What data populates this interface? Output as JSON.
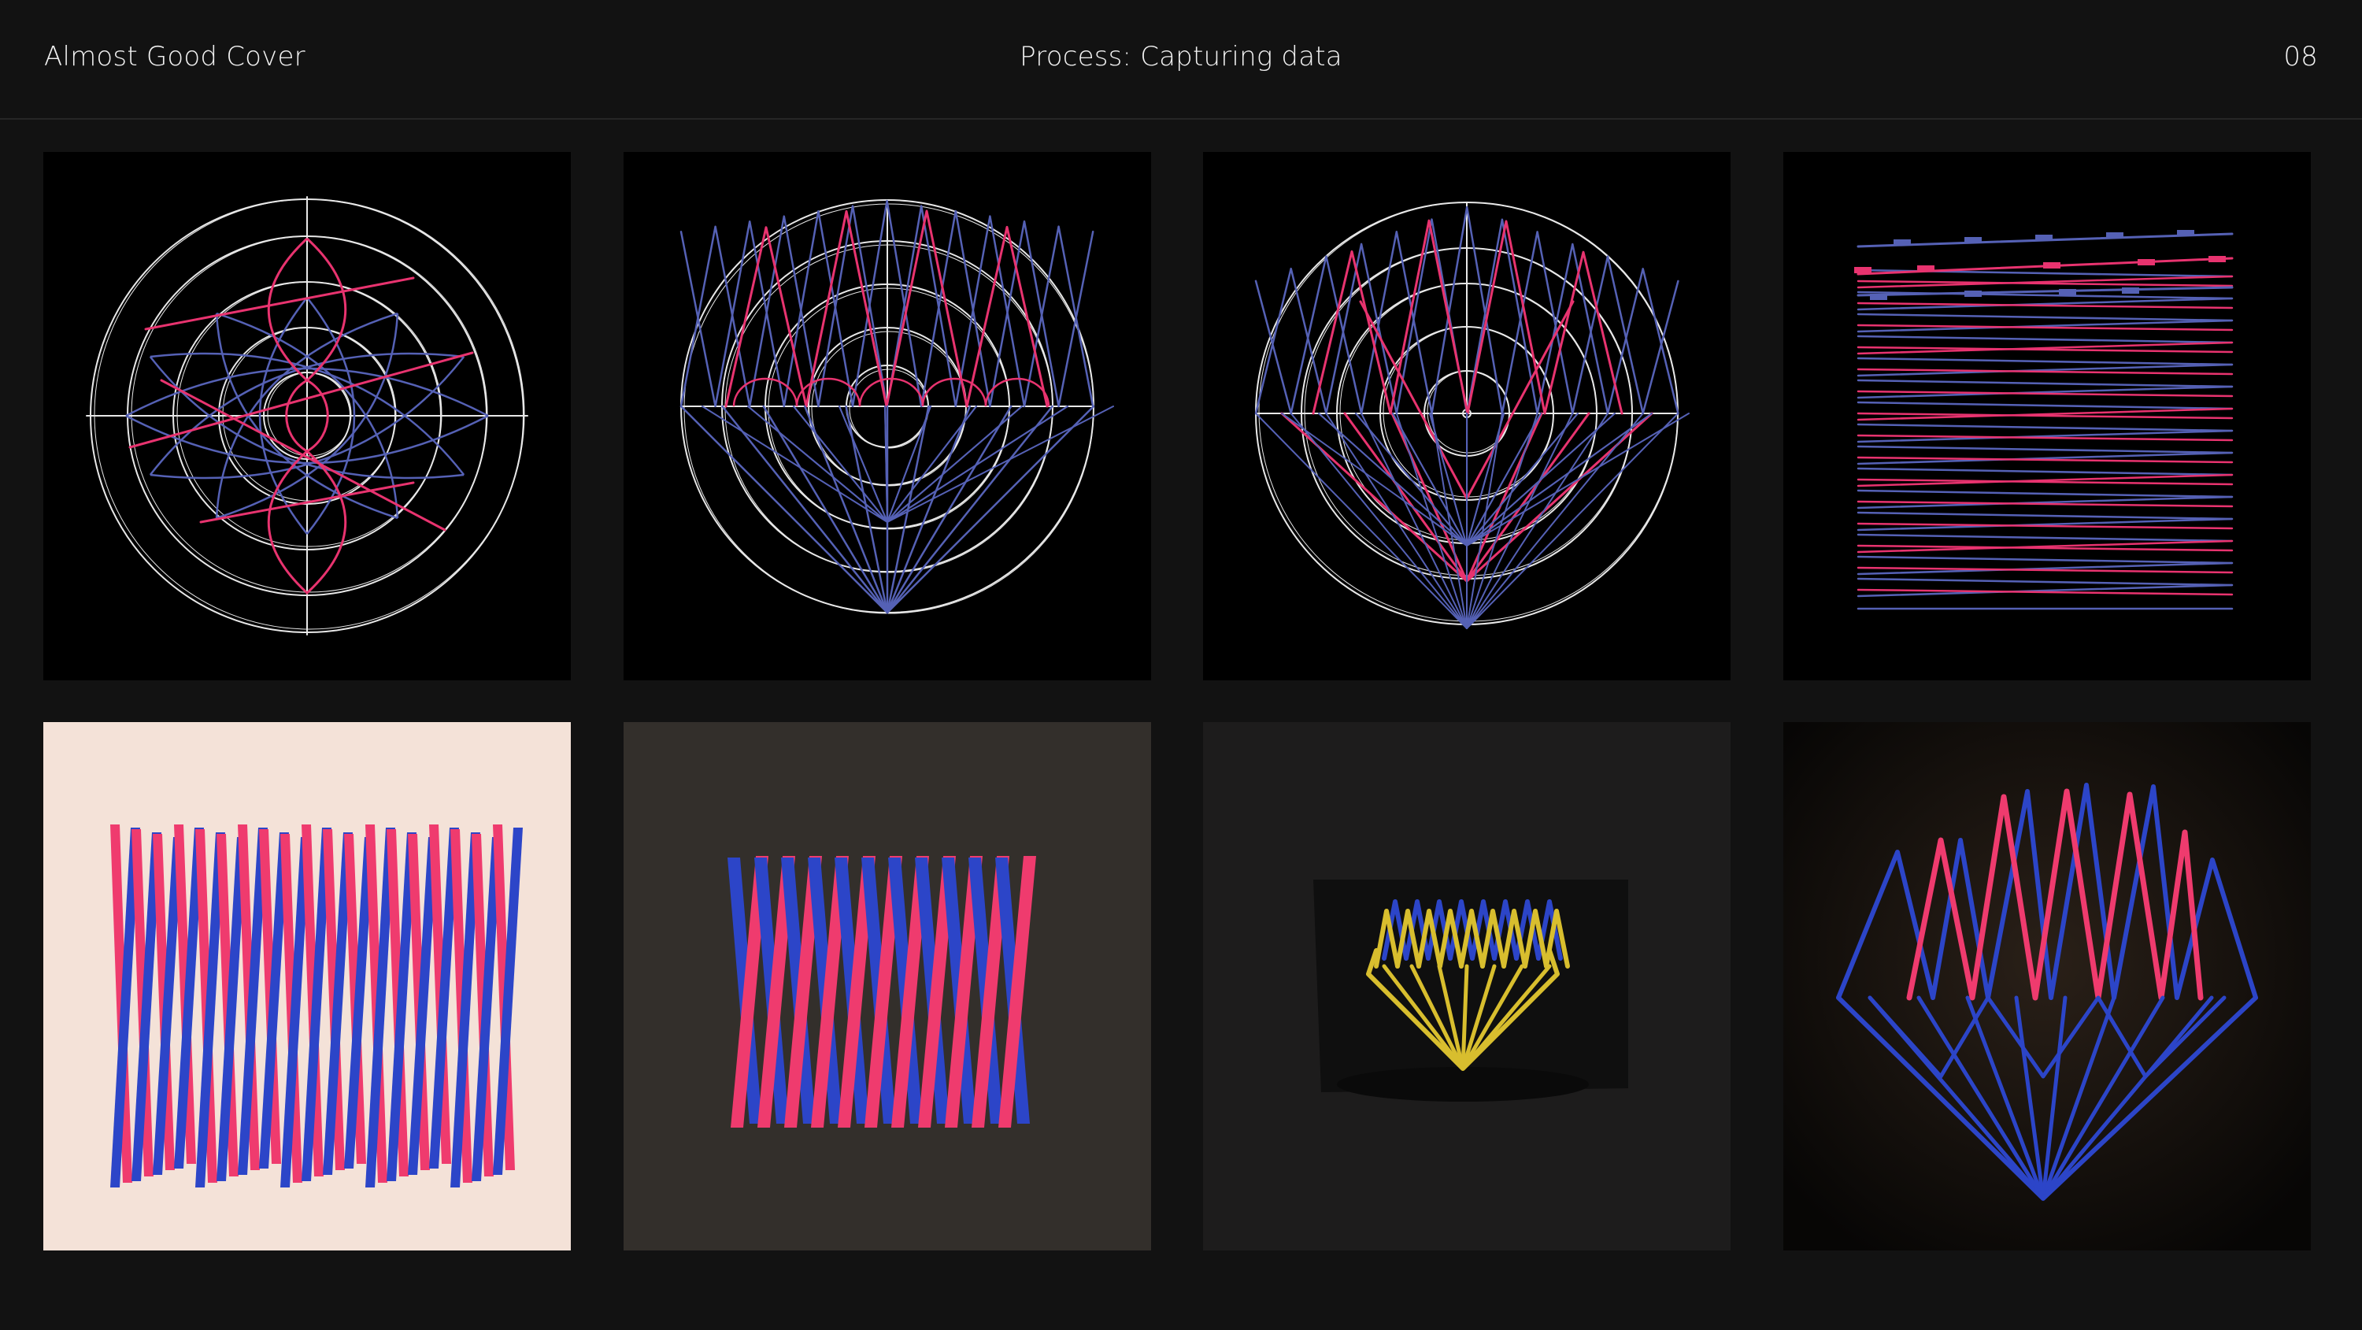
{
  "header": {
    "left_title": "Almost Good Cover",
    "center_title": "Process: Capturing data",
    "page_number": "08"
  },
  "colors": {
    "background": "#121212",
    "tile_black": "#000000",
    "line_white": "#e8e8e8",
    "line_blue": "#5561b5",
    "line_pink": "#e8336f",
    "tape_blue": "#2c45c8",
    "tape_pink": "#ef3b6e",
    "tape_yellow": "#d8be2e",
    "paper_cream": "#f4e2d8",
    "paper_gray": "#332f2b"
  },
  "tiles": [
    {
      "row": 1,
      "col": 1,
      "kind": "drawing",
      "subject": "polar-circle-lobes"
    },
    {
      "row": 1,
      "col": 2,
      "kind": "drawing",
      "subject": "circle-zigzag-upper"
    },
    {
      "row": 1,
      "col": 3,
      "kind": "drawing",
      "subject": "circle-zigzag-full"
    },
    {
      "row": 1,
      "col": 4,
      "kind": "drawing",
      "subject": "horizontal-zigzag-lines"
    },
    {
      "row": 2,
      "col": 1,
      "kind": "photo",
      "subject": "pink-blue-tape-zigzag-on-cream-paper"
    },
    {
      "row": 2,
      "col": 2,
      "kind": "photo",
      "subject": "pink-blue-tape-zigzag-on-gray-paper"
    },
    {
      "row": 2,
      "col": 3,
      "kind": "photo",
      "subject": "yellow-blue-tape-fan-model"
    },
    {
      "row": 2,
      "col": 4,
      "kind": "photo",
      "subject": "pink-blue-fan-model-dark"
    }
  ]
}
